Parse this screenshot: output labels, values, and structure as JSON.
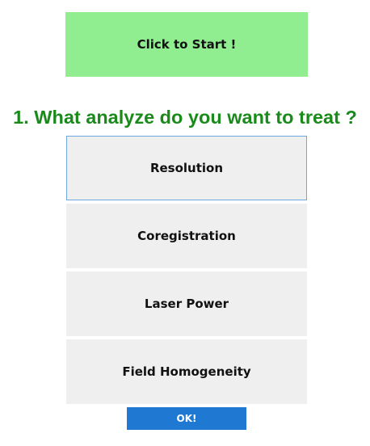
{
  "start_button": {
    "label": "Click to Start !"
  },
  "question": {
    "text": "1. What analyze do you want to treat ?"
  },
  "options": [
    {
      "label": "Resolution",
      "selected": true
    },
    {
      "label": "Coregistration",
      "selected": false
    },
    {
      "label": "Laser Power",
      "selected": false
    },
    {
      "label": "Field Homogeneity",
      "selected": false
    }
  ],
  "ok_button": {
    "label": "OK!"
  },
  "colors": {
    "start_bg": "#90ee90",
    "question_text": "#1a8a1a",
    "option_bg": "#efefef",
    "selected_border": "#6fa8dc",
    "ok_bg": "#1f78d1"
  }
}
